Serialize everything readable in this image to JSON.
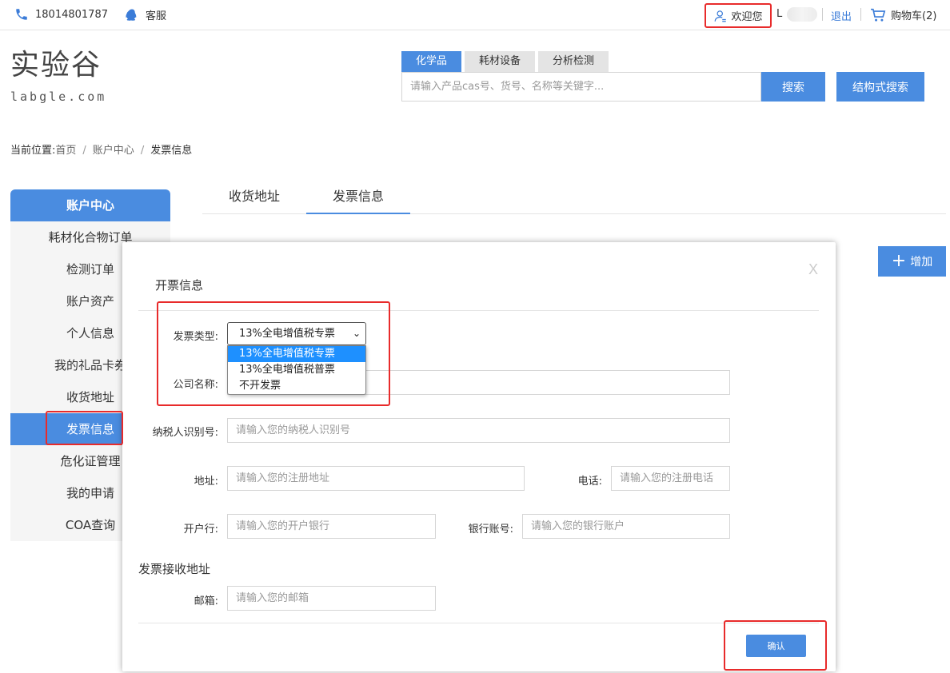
{
  "topbar": {
    "phone": "18014801787",
    "service": "客服",
    "welcome": "欢迎您",
    "user": "L",
    "logout": "退出",
    "cart": "购物车(2)"
  },
  "logo": {
    "cn": "实验谷",
    "en": "labgle.com"
  },
  "search": {
    "tabs": [
      "化学品",
      "耗材设备",
      "分析检测"
    ],
    "active_tab": 0,
    "placeholder": "请输入产品cas号、货号、名称等关键字...",
    "search_label": "搜索",
    "structure_label": "结构式搜索"
  },
  "breadcrumb": {
    "prefix": "当前位置:",
    "items": [
      "首页",
      "账户中心",
      "发票信息"
    ]
  },
  "sidebar": {
    "title": "账户中心",
    "items": [
      "耗材化合物订单",
      "检测订单",
      "账户资产",
      "个人信息",
      "我的礼品卡券",
      "收货地址",
      "发票信息",
      "危化证管理",
      "我的申请",
      "COA查询"
    ],
    "active_index": 6
  },
  "content_tabs": [
    "收货地址",
    "发票信息"
  ],
  "add_label": "增加",
  "modal": {
    "close": "X",
    "title": "开票信息",
    "invoice_type_label": "发票类型:",
    "invoice_type_value": "13%全电增值税专票",
    "invoice_options": [
      "13%全电增值税专票",
      "13%全电增值税普票",
      "不开发票"
    ],
    "company_label": "公司名称:",
    "taxid_label": "纳税人识别号:",
    "taxid_placeholder": "请输入您的纳税人识别号",
    "address_label": "地址:",
    "address_placeholder": "请输入您的注册地址",
    "phone_label": "电话:",
    "phone_placeholder": "请输入您的注册电话",
    "bank_label": "开户行:",
    "bank_placeholder": "请输入您的开户银行",
    "account_label": "银行账号:",
    "account_placeholder": "请输入您的银行账户",
    "receive_title": "发票接收地址",
    "email_label": "邮箱:",
    "email_placeholder": "请输入您的邮箱",
    "confirm_label": "确认"
  },
  "colors": {
    "accent": "#4a8ce0",
    "highlight": "#e82b2b",
    "dropdown_selected": "#1e90ff"
  }
}
